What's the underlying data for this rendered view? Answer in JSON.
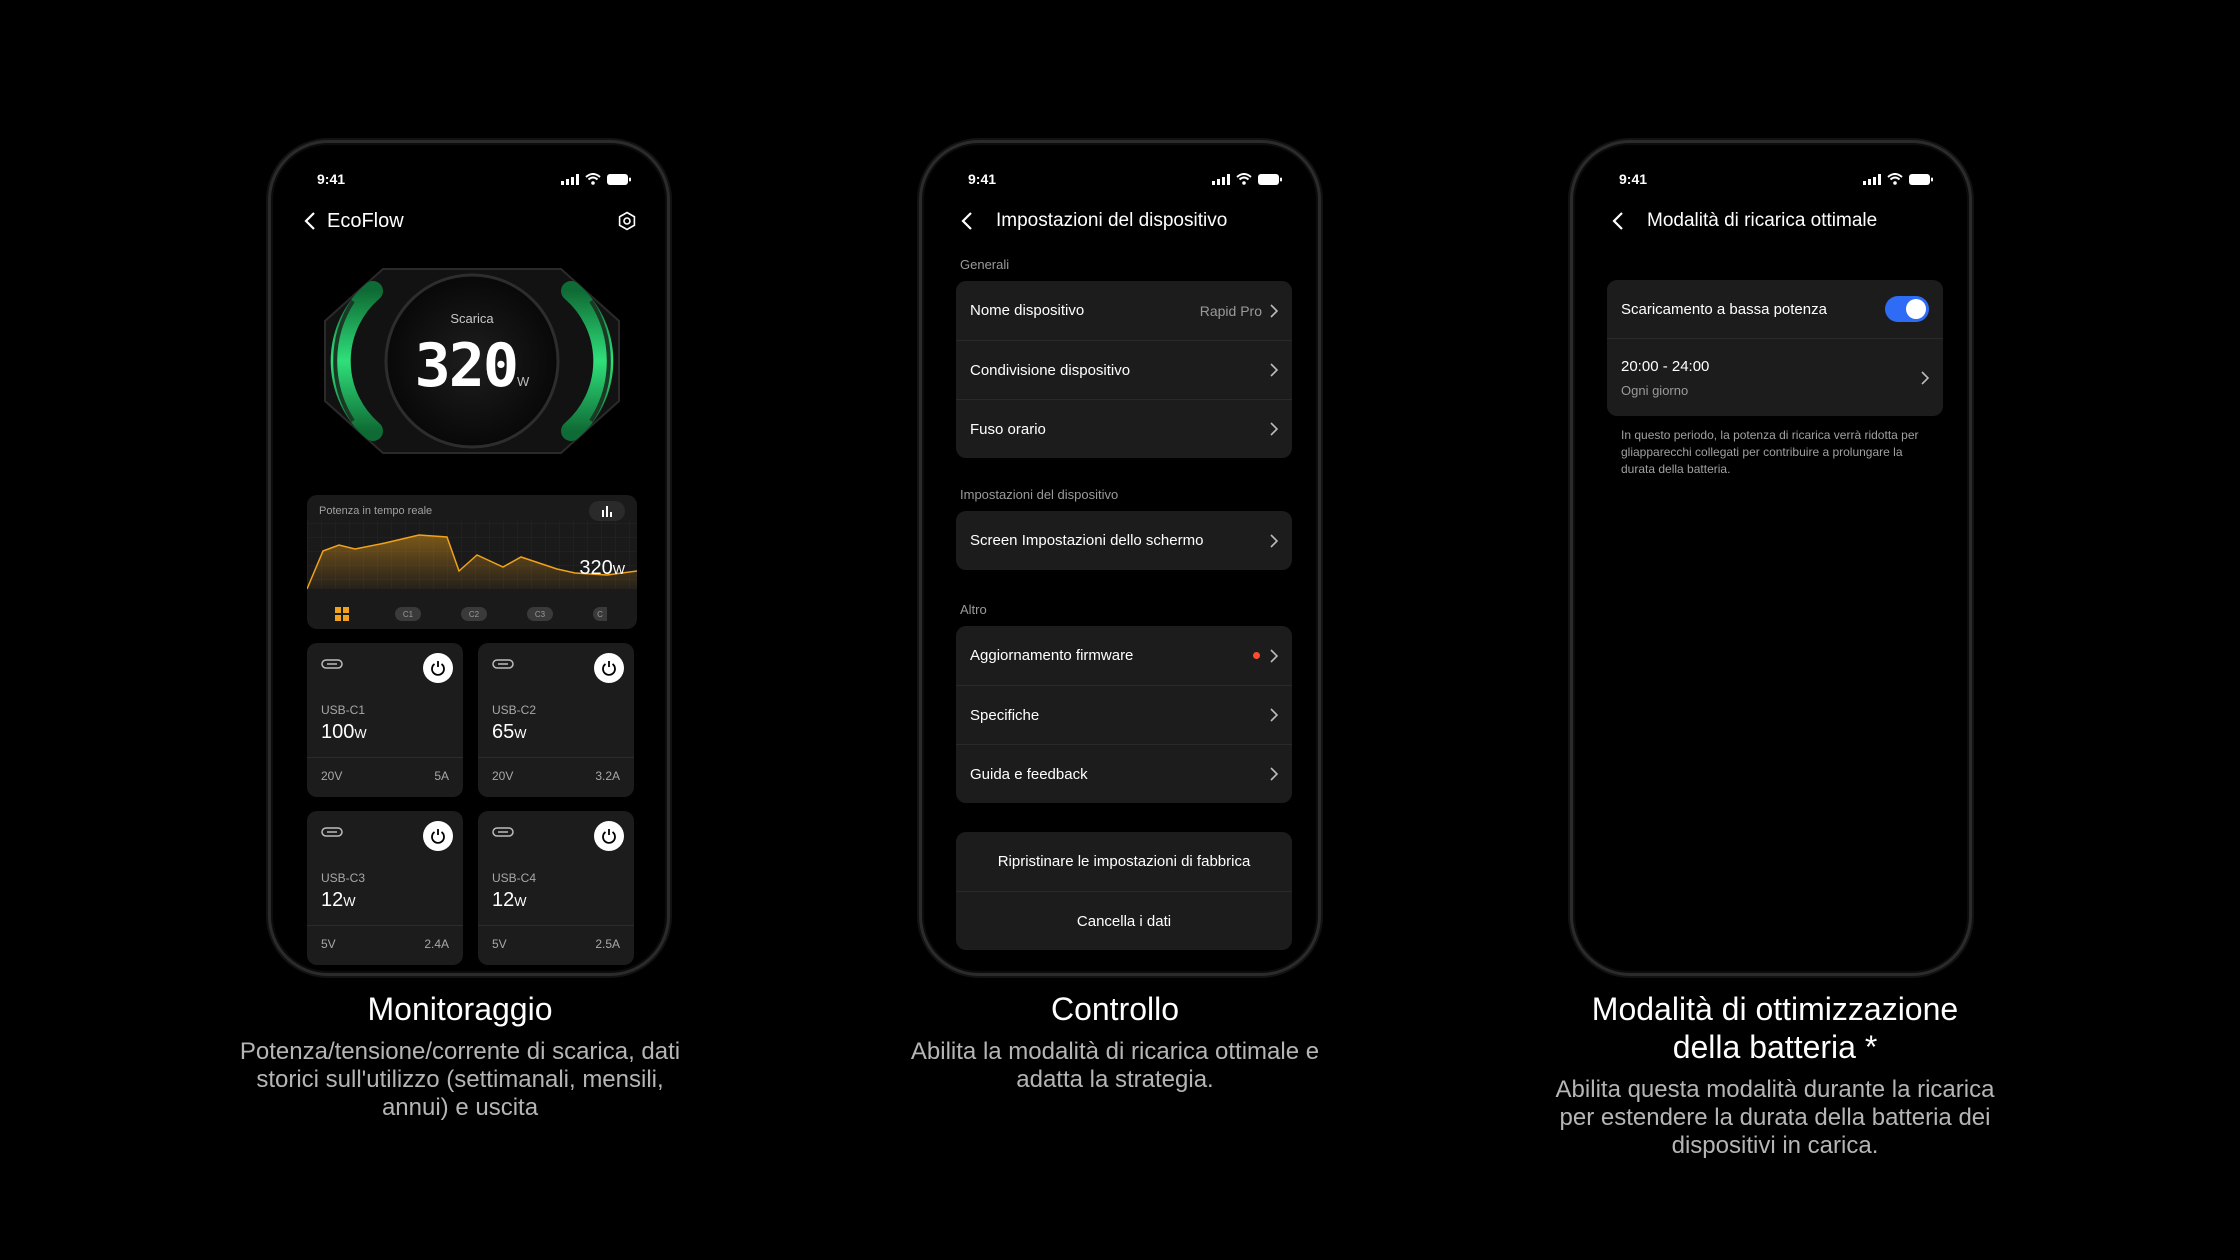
{
  "status": {
    "time": "9:41"
  },
  "colors": {
    "accent_green": "#2fe07a",
    "accent_orange": "#f0a21a",
    "toggle_blue": "#2f6cf6",
    "badge_red": "#ff4b2b"
  },
  "phone1": {
    "title": "EcoFlow",
    "gauge": {
      "label": "Scarica",
      "value": "320",
      "unit": "W"
    },
    "chart": {
      "title": "Potenza in tempo reale",
      "value": "320",
      "unit": "W",
      "tabs": [
        "C1",
        "C2",
        "C3",
        "C"
      ]
    },
    "ports": [
      {
        "name": "USB-C1",
        "watts": "100",
        "unit": "W",
        "volt": "20V",
        "amp": "5A"
      },
      {
        "name": "USB-C2",
        "watts": "65",
        "unit": "W",
        "volt": "20V",
        "amp": "3.2A"
      },
      {
        "name": "USB-C3",
        "watts": "12",
        "unit": "W",
        "volt": "5V",
        "amp": "2.4A"
      },
      {
        "name": "USB-C4",
        "watts": "12",
        "unit": "W",
        "volt": "5V",
        "amp": "2.5A"
      }
    ]
  },
  "phone2": {
    "title": "Impostazioni del dispositivo",
    "sections": [
      {
        "label": "Generali",
        "rows": [
          {
            "label": "Nome dispositivo",
            "value": "Rapid Pro"
          },
          {
            "label": "Condivisione dispositivo"
          },
          {
            "label": "Fuso orario"
          }
        ]
      },
      {
        "label": "Impostazioni del dispositivo",
        "rows": [
          {
            "label": "Screen Impostazioni dello schermo"
          }
        ]
      },
      {
        "label": "Altro",
        "rows": [
          {
            "label": "Aggiornamento firmware"
          },
          {
            "label": "Specifiche"
          },
          {
            "label": "Guida e feedback"
          }
        ]
      }
    ],
    "actions": [
      "Ripristinare le impostazioni di fabbrica",
      "Cancella i dati"
    ]
  },
  "phone3": {
    "title": "Modalità di ricarica ottimale",
    "toggle_label": "Scaricamento a bassa potenza",
    "schedule_time": "20:00 - 24:00",
    "schedule_repeat": "Ogni giorno",
    "note": "In questo periodo, la potenza di ricarica verrà ridotta per gliapparecchi collegati per contribuire a prolungare la durata della batteria."
  },
  "captions": [
    {
      "title": "Monitoraggio",
      "text": "Potenza/tensione/corrente di scarica, dati storici sull'utilizzo (settimanali, mensili, annui) e uscita"
    },
    {
      "title": "Controllo",
      "text": "Abilita la modalità di ricarica ottimale e adatta la strategia."
    },
    {
      "title": "Modalità di ottimizzazione della batteria *",
      "text": "Abilita questa modalità durante la ricarica per estendere la durata della batteria dei dispositivi in carica."
    }
  ]
}
